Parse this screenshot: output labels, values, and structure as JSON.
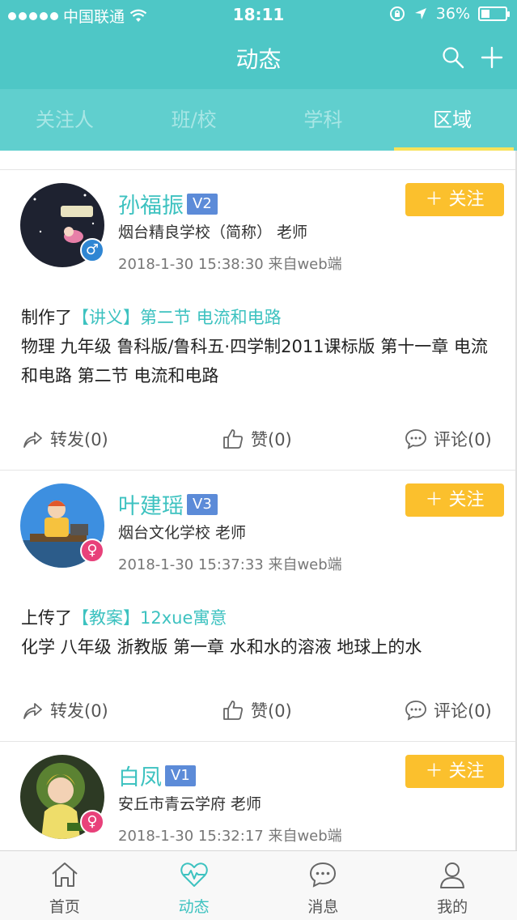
{
  "status_bar": {
    "carrier": "中国联通",
    "time": "18:11",
    "battery": "36%",
    "battery_level": 0.36
  },
  "nav": {
    "title": "动态"
  },
  "tabs": [
    {
      "label": "关注人",
      "active": false
    },
    {
      "label": "班/校",
      "active": false
    },
    {
      "label": "学科",
      "active": false
    },
    {
      "label": "区域",
      "active": true
    }
  ],
  "posts": [
    {
      "name": "孙福振",
      "level": "V2",
      "gender": "male",
      "school": "烟台精良学校（简称） 老师",
      "time": "2018-1-30 15:38:30 来自web端",
      "follow_label": "关注",
      "action": "制作了",
      "resource": "【讲义】第二节 电流和电路",
      "detail": "物理 九年级 鲁科版/鲁科五·四学制2011课标版 第十一章 电流和电路 第二节 电流和电路",
      "forward": "转发(0)",
      "like": "赞(0)",
      "comment": "评论(0)"
    },
    {
      "name": "叶建瑶",
      "level": "V3",
      "gender": "female",
      "school": "烟台文化学校 老师",
      "time": "2018-1-30 15:37:33 来自web端",
      "follow_label": "关注",
      "action": "上传了",
      "resource": "【教案】12xue寓意",
      "detail": "化学 八年级 浙教版 第一章 水和水的溶液 地球上的水",
      "forward": "转发(0)",
      "like": "赞(0)",
      "comment": "评论(0)"
    },
    {
      "name": "白凤",
      "level": "V1",
      "gender": "female",
      "school": "安丘市青云学府 老师",
      "time": "2018-1-30 15:32:17 来自web端",
      "follow_label": "关注"
    }
  ],
  "bottom_nav": [
    {
      "label": "首页",
      "icon": "home-icon",
      "active": false
    },
    {
      "label": "动态",
      "icon": "pulse-heart-icon",
      "active": true
    },
    {
      "label": "消息",
      "icon": "message-bubble-icon",
      "active": false
    },
    {
      "label": "我的",
      "icon": "person-icon",
      "active": false
    }
  ],
  "colors": {
    "primary": "#4ec7c6",
    "tab_bar": "#60cfce",
    "accent": "#3dc2c0",
    "follow": "#fbc02d",
    "level": "#5c8bd8",
    "tab_indicator": "#f7e25a"
  }
}
